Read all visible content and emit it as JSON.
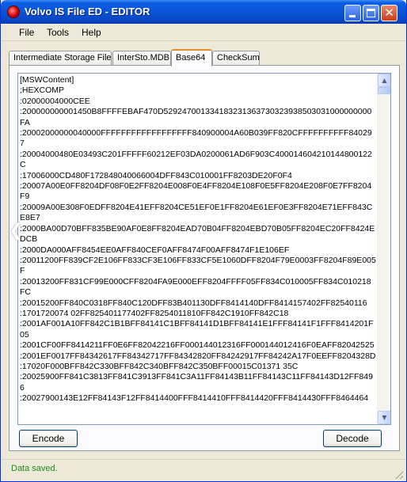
{
  "window": {
    "title": "Volvo IS File ED - EDITOR",
    "icons": {
      "app": "volvo-app-icon",
      "minimize": "minimize-icon",
      "maximize": "maximize-icon",
      "close": "close-icon"
    },
    "close_glyph": "✕"
  },
  "menu": {
    "file": "File",
    "tools": "Tools",
    "help": "Help"
  },
  "tabs": [
    {
      "label": "Intermediate Storage File"
    },
    {
      "label": "InterSto.MDB"
    },
    {
      "label": "Base64",
      "selected": true
    },
    {
      "label": "CheckSum"
    }
  ],
  "editor": {
    "content": "[MSWContent]\n;HEXCOMP\n:02000004000CEE\n:200000000001450B8FFFFEBAF470D529247001334183231363730323938503031000000000FA\n:20002000000040000FFFFFFFFFFFFFFFFFF840900004A60B039FF820CFFFFFFFFFF840297\n:20004000480E03493C201FFFFF60212EF03DA0200061AD6F903C400014604210144800122C\n:17006000CD480F172848040066004DFF843C010001FF8203DE20F0F4\n:20007A00E0FF8204DF08F0E2FF8204E008F0E4FF8204E108F0E5FF8204E208F0E7FF8204F9\n:20009A00E308F0EDFF8204E41EFF8204CE51EF0E1FF8204E61EF0E3FF8204E71EFF843CE8E7\n:2000BA00D70BFF835BE90AF0E8FF8204EAD70B04FF8204EBD70B05FF8204EC20FF8424EDCB\n:2000DA000AFF8454EE0AFF840CEF0AFF8474F00AFF8474F1E106EF\n:20011200FF839CF2E106FF833CF3E106FF833CF5E1060DFF8204F79E0003FF8204F89E005F\n:20013200FF831CF99E000CFF8204FA9E000EFF8204FFFF05FF834C010005FF834C010218FC\n:20015200FF840C0318FF840C120DFF83B401130DFF8414140DFF8414157402FF82540116\n:1701720074 02FF825401177402FF8254011810FF842C1910FF842C18\n:2001AF001A10FF842C1B1BFF84141C1BFF84141D1BFF84141E1FFF84141F1FFF8414201F05\n:2001CF00FF8414211FF0E6FF82042216FF000144012316FF000144012416F0EAFF82042525\n:2001EF0017FF84342617FF84342717FF84342820FF84242917FF84242A17F0EEFF8204328D\n:17020F000BFF842C330BFF842C340BFF842C350BFF00015C01371 35C\n:20025900FF841C3813FF841C3913FF841C3A11FF84143B11FF84143C11FF84143D12FF8496\n:20027900143E12FF84143F12FF8414400FFF8414410FFF8414420FFF8414430FFF8464464"
  },
  "buttons": {
    "encode": "Encode",
    "decode": "Decode"
  },
  "status": {
    "text": "Data saved."
  }
}
